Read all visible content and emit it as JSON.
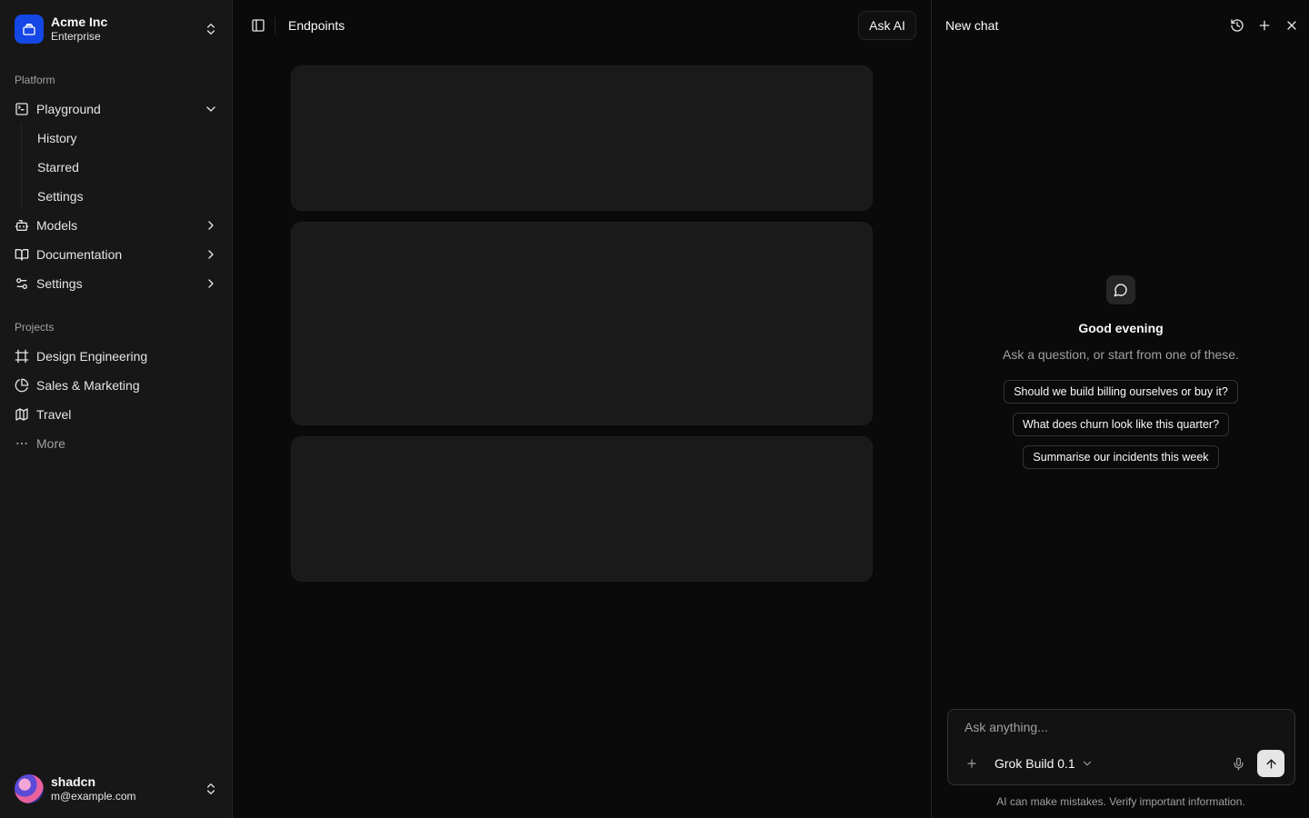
{
  "team": {
    "name": "Acme Inc",
    "plan": "Enterprise"
  },
  "platform": {
    "label": "Platform",
    "items": [
      {
        "label": "Playground",
        "subitems": [
          "History",
          "Starred",
          "Settings"
        ]
      },
      {
        "label": "Models"
      },
      {
        "label": "Documentation"
      },
      {
        "label": "Settings"
      }
    ]
  },
  "projects": {
    "label": "Projects",
    "items": [
      {
        "label": "Design Engineering"
      },
      {
        "label": "Sales & Marketing"
      },
      {
        "label": "Travel"
      },
      {
        "label": "More"
      }
    ]
  },
  "user": {
    "name": "shadcn",
    "email": "m@example.com"
  },
  "header": {
    "breadcrumb": "Endpoints",
    "ask_ai": "Ask AI"
  },
  "chat": {
    "title": "New chat",
    "greeting": "Good evening",
    "subtitle": "Ask a question, or start from one of these.",
    "suggestions": [
      "Should we build billing ourselves or buy it?",
      "What does churn look like this quarter?",
      "Summarise our incidents this week"
    ],
    "input_placeholder": "Ask anything...",
    "model": "Grok Build 0.1",
    "disclaimer": "AI can make mistakes. Verify important information."
  },
  "colors": {
    "accent": "#1447e6",
    "background": "#0a0a0a",
    "sidebar": "#171717",
    "card": "#1a1a1a"
  }
}
